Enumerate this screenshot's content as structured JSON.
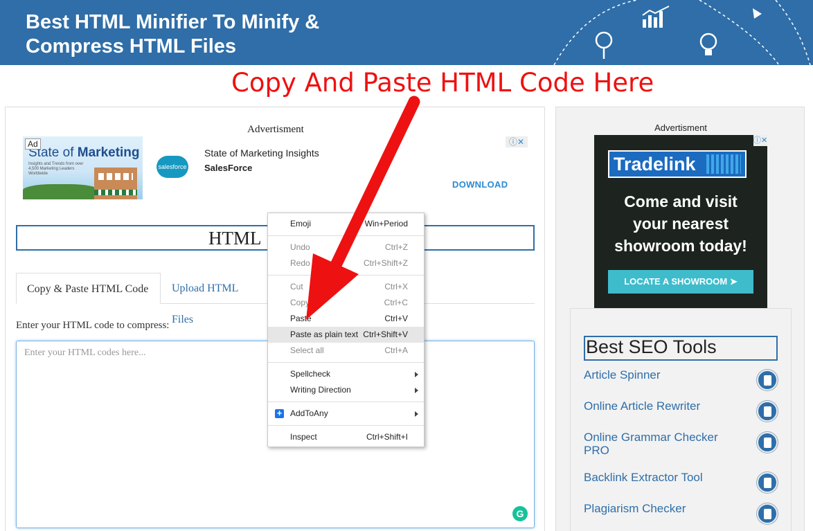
{
  "banner": {
    "title_line1": "Best HTML Minifier To Minify &",
    "title_line2": "Compress HTML Files"
  },
  "headline": "Copy And Paste HTML Code Here",
  "main": {
    "ad_caption": "Advertisment",
    "ad": {
      "badge": "Ad",
      "image_title_plain": "State of ",
      "image_title_bold": "Marketing",
      "image_subtitle": "Insights and Trends from over 4,500 Marketing Leaders Worldwide",
      "logo_text": "salesforce",
      "title": "State of Marketing Insights",
      "brand": "SalesForce",
      "cta": "DOWNLOAD",
      "choices": "ⓘ✕"
    },
    "section_title": "HTML",
    "tabs": [
      {
        "label": "Copy & Paste HTML Code",
        "active": true
      },
      {
        "label": "Upload HTML Files",
        "active": false
      }
    ],
    "input_label": "Enter your HTML code to compress:",
    "input_placeholder": "Enter your HTML codes here...",
    "grammarly_icon": "G"
  },
  "sidebar": {
    "ad_caption": "Advertisment",
    "ad": {
      "brand": "Tradelink",
      "registered": "®",
      "line1": "Come and visit",
      "line2": "your nearest",
      "line3": "showroom today!",
      "cta": "LOCATE A SHOWROOM  ➤",
      "choices": "ⓘ✕"
    },
    "tools_title": "Best SEO Tools",
    "tools": [
      {
        "label": "Article Spinner",
        "icon": "spinner-icon"
      },
      {
        "label": "Online Article Rewriter",
        "icon": "rewriter-icon"
      },
      {
        "label": "Online Grammar Checker PRO",
        "icon": "grammar-icon"
      },
      {
        "label": "Backlink Extractor Tool",
        "icon": "backlink-icon"
      },
      {
        "label": "Plagiarism Checker",
        "icon": "plagiarism-icon"
      }
    ]
  },
  "context_menu": {
    "items": [
      {
        "label": "Emoji",
        "shortcut": "Win+Period",
        "disabled": false
      },
      {
        "label": "Undo",
        "shortcut": "Ctrl+Z",
        "disabled": true
      },
      {
        "label": "Redo",
        "shortcut": "Ctrl+Shift+Z",
        "disabled": true
      },
      {
        "label": "Cut",
        "shortcut": "Ctrl+X",
        "disabled": true
      },
      {
        "label": "Copy",
        "shortcut": "Ctrl+C",
        "disabled": true
      },
      {
        "label": "Paste",
        "shortcut": "Ctrl+V",
        "disabled": false
      },
      {
        "label": "Paste as plain text",
        "shortcut": "Ctrl+Shift+V",
        "disabled": false,
        "highlighted": true
      },
      {
        "label": "Select all",
        "shortcut": "Ctrl+A",
        "disabled": true
      },
      {
        "label": "Spellcheck",
        "shortcut": "",
        "submenu": true
      },
      {
        "label": "Writing Direction",
        "shortcut": "",
        "submenu": true
      },
      {
        "label": "AddToAny",
        "shortcut": "",
        "submenu": true,
        "icon": "plus-icon"
      },
      {
        "label": "Inspect",
        "shortcut": "Ctrl+Shift+I",
        "disabled": false
      }
    ]
  },
  "colors": {
    "banner": "#2f6ea8",
    "headline": "#ee1111",
    "arrow": "#ee1111",
    "link": "#2f6ea8"
  }
}
